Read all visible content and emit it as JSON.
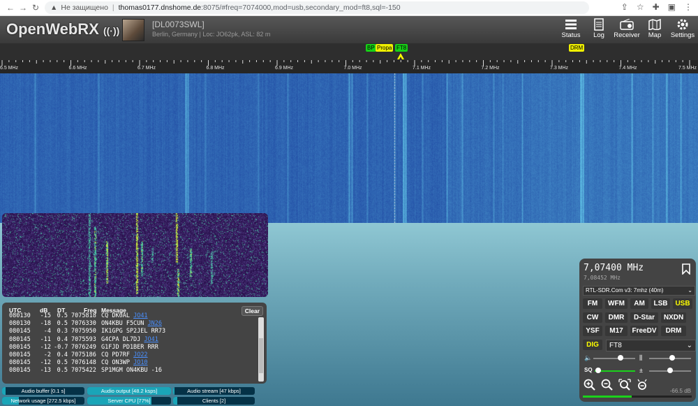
{
  "browser": {
    "security_warning": "Не защищено",
    "url_host": "thomas0177.dnshome.de",
    "url_path": ":8075/#freq=7074000,mod=usb,secondary_mod=ft8,sql=-150"
  },
  "header": {
    "logo_text": "OpenWebRX",
    "receiver_title": "[DL0073SWL]",
    "receiver_desc": "Berlin, Germany | Loc: JO62pk, ASL: 82 m",
    "menu": [
      {
        "label": "Status",
        "icon": "status-icon"
      },
      {
        "label": "Log",
        "icon": "log-icon"
      },
      {
        "label": "Receiver",
        "icon": "receiver-icon"
      },
      {
        "label": "Map",
        "icon": "map-icon"
      },
      {
        "label": "Settings",
        "icon": "settings-icon"
      }
    ]
  },
  "bookmarks": [
    {
      "label": "BP",
      "color": "#16d016"
    },
    {
      "label": "Propa",
      "color": "#f0f000"
    },
    {
      "label": "FT8",
      "color": "#16d016"
    },
    {
      "label": "DRM",
      "color": "#f0f000"
    }
  ],
  "scale_ticks": [
    "6.5 MHz",
    "6.6 MHz",
    "6.7 MHz",
    "6.8 MHz",
    "6.9 MHz",
    "7.0 MHz",
    "7.1 MHz",
    "7.2 MHz",
    "7.3 MHz",
    "7.4 MHz",
    "7.5 MHz"
  ],
  "decoder": {
    "headers": {
      "utc": "UTC",
      "db": "dB",
      "dt": "DT",
      "freq": "Freq",
      "message": "Message"
    },
    "clear_label": "Clear",
    "rows": [
      {
        "utc": "080130",
        "db": "-15",
        "dt": "0.5",
        "freq": "7075818",
        "msg": "CQ DK0AL",
        "grid": "JO41"
      },
      {
        "utc": "080130",
        "db": "-18",
        "dt": "0.5",
        "freq": "7076330",
        "msg": "ON4KBU F5CUN",
        "grid": "JN26"
      },
      {
        "utc": "080145",
        "db": "-4",
        "dt": "0.3",
        "freq": "7075950",
        "msg": "IK1GPG SP2JEL RR73",
        "grid": ""
      },
      {
        "utc": "080145",
        "db": "-11",
        "dt": "0.4",
        "freq": "7075593",
        "msg": "G4CPA DL7DJ",
        "grid": "JO41"
      },
      {
        "utc": "080145",
        "db": "-12",
        "dt": "-0.7",
        "freq": "7076249",
        "msg": "G1FJD PD1BER RRR",
        "grid": ""
      },
      {
        "utc": "080145",
        "db": "-2",
        "dt": "0.4",
        "freq": "7075186",
        "msg": "CQ PD7RF",
        "grid": "JO22"
      },
      {
        "utc": "080145",
        "db": "-12",
        "dt": "0.5",
        "freq": "7076148",
        "msg": "CQ ON3WP",
        "grid": "JO10"
      },
      {
        "utc": "080145",
        "db": "-13",
        "dt": "0.5",
        "freq": "7075422",
        "msg": "SP1MGM ON4KBU -16",
        "grid": ""
      }
    ]
  },
  "status_bars": [
    {
      "label": "Audio buffer [0.1 s]",
      "fill": 0.04
    },
    {
      "label": "Audio output [48.2 ksps]",
      "fill": 1.0
    },
    {
      "label": "Audio stream [47 kbps]",
      "fill": 0.02
    },
    {
      "label": "Network usage [272.5 kbps]",
      "fill": 0.2
    },
    {
      "label": "Server CPU [77%]",
      "fill": 0.77
    },
    {
      "label": "Clients [2]",
      "fill": 0.05
    }
  ],
  "receiver": {
    "frequency": "7,07400 MHz",
    "offset_frequency": "7,08452 MHz",
    "profile": "RTL-SDR.Com v3: 7mhz (40m)",
    "modes": [
      "FM",
      "WFM",
      "AM",
      "LSB",
      "USB",
      "CW",
      "DMR",
      "D-Star",
      "NXDN",
      "YSF",
      "M17",
      "FreeDV",
      "DRM",
      "DIG"
    ],
    "active_modes": [
      "USB",
      "DIG"
    ],
    "secondary_mode": "FT8",
    "smeter_value": "-66.5 dB",
    "smeter_level": 0.45,
    "volume": 0.65,
    "squelch": 0.05,
    "waterfall_max": 0.55,
    "waterfall_min": 0.5
  },
  "colors": {
    "waterfall_base": "#2a4ec2",
    "accent": "#1aa5b8",
    "active_mode": "#ffff00"
  }
}
